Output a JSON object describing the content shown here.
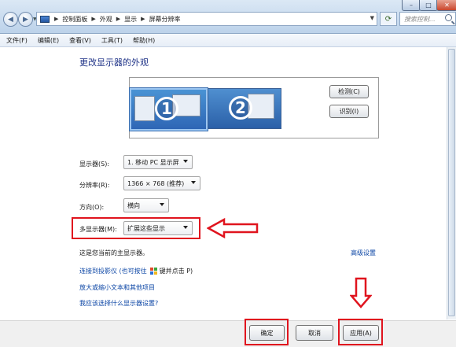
{
  "window": {
    "controls": [
      "–",
      "□",
      "✕"
    ],
    "breadcrumb": [
      "控制面板",
      "外观",
      "显示",
      "屏幕分辨率"
    ],
    "search_placeholder": "搜索控制..."
  },
  "menu": [
    "文件(F)",
    "编辑(E)",
    "查看(V)",
    "工具(T)",
    "帮助(H)"
  ],
  "page": {
    "heading": "更改显示器的外观",
    "detect_button": "检测(C)",
    "identify_button": "识别(I)",
    "monitors": [
      "1",
      "2"
    ]
  },
  "settings": {
    "display_label": "显示器(S):",
    "display_value": "1. 移动 PC 显示屏",
    "resolution_label": "分辨率(R):",
    "resolution_value": "1366 × 768 (推荐)",
    "orientation_label": "方向(O):",
    "orientation_value": "横向",
    "multi_label": "多显示器(M):",
    "multi_value": "扩展这些显示"
  },
  "info": {
    "primary_text": "这是您当前的主显示器。",
    "advanced_link": "高级设置"
  },
  "links": {
    "projector_text": "连接到投影仪 (也可按住",
    "projector_key": "键并点击 P)",
    "text_size": "放大或缩小文本和其他项目",
    "help": "我应该选择什么显示器设置?"
  },
  "buttons": {
    "ok": "确定",
    "cancel": "取消",
    "apply": "应用(A)"
  },
  "colors": {
    "annotation_red": "#e0141e",
    "link_blue": "#0b45a5",
    "heading_blue": "#1e3287"
  }
}
